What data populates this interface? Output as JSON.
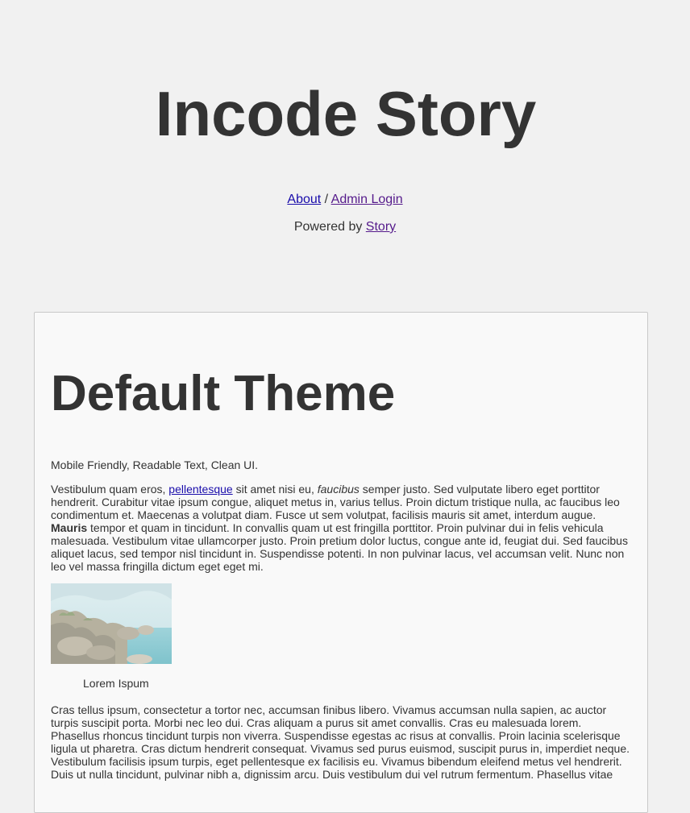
{
  "header": {
    "site_title": "Incode Story",
    "nav": {
      "about": "About",
      "separator": " / ",
      "admin_login": "Admin Login"
    },
    "powered_by": {
      "prefix": "Powered by ",
      "link": "Story"
    }
  },
  "post": {
    "title": "Default Theme",
    "tagline": "Mobile Friendly, Readable Text, Clean UI.",
    "body1": {
      "t1": "Vestibulum quam eros, ",
      "link": "pellentesque",
      "t2": " sit amet nisi eu, ",
      "em": "faucibus",
      "t3": " semper justo. Sed vulputate libero eget porttitor hendrerit. Curabitur vitae ipsum congue, aliquet metus in, varius tellus. Proin dictum tristique nulla, ac faucibus leo condimentum et. Maecenas a volutpat diam. Fusce ut sem volutpat, facilisis mauris sit amet, interdum augue. ",
      "strong": "Mauris",
      "t4": " tempor et quam in tincidunt. In convallis quam ut est fringilla porttitor. Proin pulvinar dui in felis vehicula malesuada. Vestibulum vitae ullamcorper justo. Proin pretium dolor luctus, congue ante id, feugiat dui. Sed faucibus aliquet lacus, sed tempor nisl tincidunt in. Suspendisse potenti. In non pulvinar lacus, vel accumsan velit. Nunc non leo vel massa fringilla dictum eget eget mi."
    },
    "figure_caption": "Lorem Ispum",
    "body2": "Cras tellus ipsum, consectetur a tortor nec, accumsan finibus libero. Vivamus accumsan nulla sapien, ac auctor turpis suscipit porta. Morbi nec leo dui. Cras aliquam a purus sit amet convallis. Cras eu malesuada lorem. Phasellus rhoncus tincidunt turpis non viverra. Suspendisse egestas ac risus at convallis. Proin lacinia scelerisque ligula ut pharetra. Cras dictum hendrerit consequat. Vivamus sed purus euismod, suscipit purus in, imperdiet neque. Vestibulum facilisis ipsum turpis, eget pellentesque ex facilisis eu. Vivamus bibendum eleifend metus vel hendrerit. Duis ut nulla tincidunt, pulvinar nibh a, dignissim arcu. Duis vestibulum dui vel rutrum fermentum. Phasellus vitae"
  }
}
